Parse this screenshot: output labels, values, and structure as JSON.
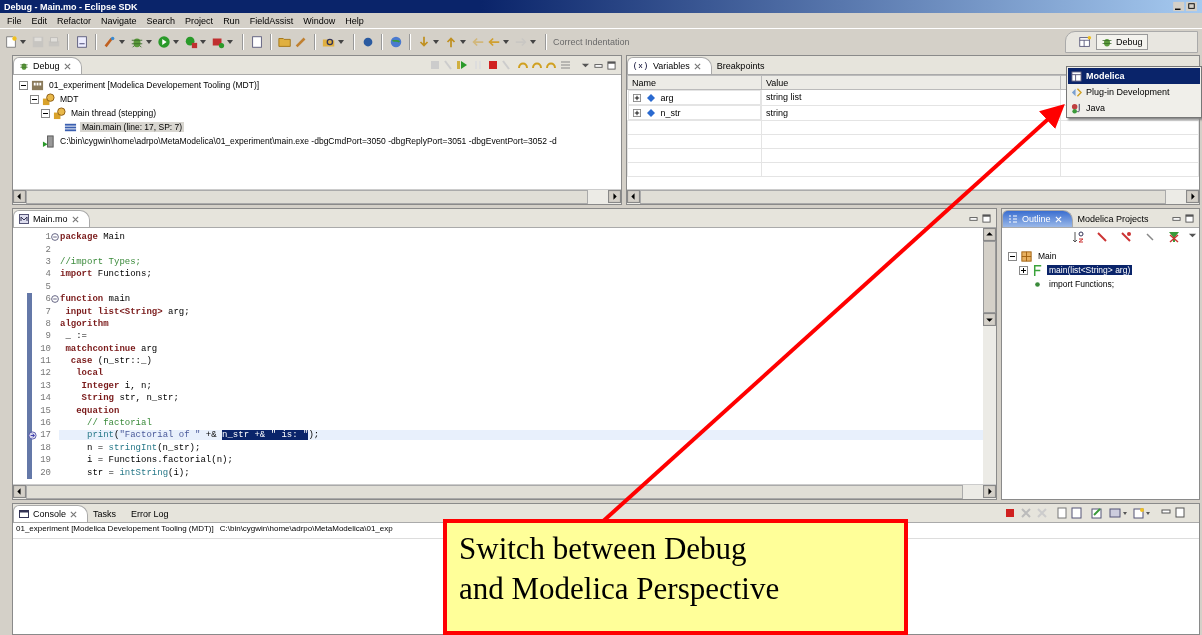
{
  "window": {
    "title": "Debug - Main.mo - Eclipse SDK"
  },
  "menu": [
    "File",
    "Edit",
    "Refactor",
    "Navigate",
    "Search",
    "Project",
    "Run",
    "FieldAssist",
    "Window",
    "Help"
  ],
  "toolbar": {
    "action": "Correct Indentation",
    "action_disabled": true
  },
  "perspectives": {
    "current": "Debug",
    "menu": [
      {
        "label": "Modelica",
        "kind": "modelica",
        "selected": true
      },
      {
        "label": "Plug-in Development",
        "kind": "plugin",
        "selected": false
      },
      {
        "label": "Java",
        "kind": "java",
        "selected": false
      }
    ]
  },
  "debug_view": {
    "focused": false,
    "tabs": [
      {
        "label": "Debug",
        "selected": true
      }
    ],
    "tree": [
      {
        "label": "01_experiment [Modelica Developement Tooling (MDT)]",
        "kind": "launch",
        "selected": false,
        "expanded": true,
        "children": [
          {
            "label": "MDT",
            "kind": "target",
            "selected": false,
            "expanded": true,
            "children": [
              {
                "label": "Main thread (stepping)",
                "kind": "thread",
                "selected": false,
                "expanded": true,
                "children": [
                  {
                    "label": "Main.main (line: 17, SP: 7)",
                    "kind": "frame",
                    "selected": true
                  }
                ]
              }
            ]
          },
          {
            "label": "C:\\bin\\cygwin\\home\\adrpo\\MetaModelica\\01_experiment\\main.exe -dbgCmdPort=3050 -dbgReplyPort=3051 -dbgEventPort=3052 -d",
            "kind": "process",
            "selected": false
          }
        ]
      }
    ]
  },
  "variables_view": {
    "focused": false,
    "tabs": [
      {
        "label": "Variables",
        "selected": true
      },
      {
        "label": "Breakpoints",
        "selected": false
      }
    ],
    "columns": [
      "Name",
      "Value"
    ],
    "rows": [
      {
        "name": "arg",
        "value": "string list"
      },
      {
        "name": "n_str",
        "value": "string"
      }
    ]
  },
  "editor": {
    "focused": false,
    "tabs": [
      {
        "label": "Main.mo",
        "selected": true
      }
    ],
    "lines": [
      {
        "number": "1",
        "fold": true,
        "changed": false,
        "current": false,
        "segments": [
          {
            "kind": "kw",
            "text": "package"
          },
          {
            "kind": "plain",
            "text": " Main"
          }
        ]
      },
      {
        "number": "2",
        "fold": false,
        "changed": false,
        "current": false
      },
      {
        "number": "3",
        "fold": false,
        "changed": false,
        "current": false,
        "segments": [
          {
            "kind": "comment",
            "text": "//import Types;"
          }
        ]
      },
      {
        "number": "4",
        "fold": false,
        "changed": false,
        "current": false,
        "segments": [
          {
            "kind": "kw",
            "text": "import"
          },
          {
            "kind": "plain",
            "text": " Functions;"
          }
        ]
      },
      {
        "number": "5",
        "fold": false,
        "changed": false,
        "current": false
      },
      {
        "number": "6",
        "fold": true,
        "changed": true,
        "current": false,
        "segments": [
          {
            "kind": "kw",
            "text": "function"
          },
          {
            "kind": "plain",
            "text": " main"
          }
        ]
      },
      {
        "number": "7",
        "fold": false,
        "changed": true,
        "current": false,
        "segments": [
          {
            "kind": "kw",
            "text": " input list<String>"
          },
          {
            "kind": "plain",
            "text": " arg;"
          }
        ]
      },
      {
        "number": "8",
        "fold": false,
        "changed": true,
        "current": false,
        "segments": [
          {
            "kind": "kw",
            "text": "algorithm"
          }
        ]
      },
      {
        "number": "9",
        "fold": false,
        "changed": true,
        "current": false,
        "segments": [
          {
            "kind": "plain",
            "text": " _ :="
          }
        ]
      },
      {
        "number": "10",
        "fold": false,
        "changed": true,
        "current": false,
        "segments": [
          {
            "kind": "kw",
            "text": " matchcontinue"
          },
          {
            "kind": "plain",
            "text": " arg"
          }
        ]
      },
      {
        "number": "11",
        "fold": false,
        "changed": true,
        "current": false,
        "segments": [
          {
            "kind": "kw",
            "text": "  case"
          },
          {
            "kind": "plain",
            "text": " (n_str::_)"
          }
        ]
      },
      {
        "number": "12",
        "fold": false,
        "changed": true,
        "current": false,
        "segments": [
          {
            "kind": "kw",
            "text": "   local"
          }
        ]
      },
      {
        "number": "13",
        "fold": false,
        "changed": true,
        "current": false,
        "segments": [
          {
            "kind": "kw",
            "text": "    Integer"
          },
          {
            "kind": "plain",
            "text": " i, n;"
          }
        ]
      },
      {
        "number": "14",
        "fold": false,
        "changed": true,
        "current": false,
        "segments": [
          {
            "kind": "kw",
            "text": "    String"
          },
          {
            "kind": "plain",
            "text": " str, n_str;"
          }
        ]
      },
      {
        "number": "15",
        "fold": false,
        "changed": true,
        "current": false,
        "segments": [
          {
            "kind": "kw",
            "text": "   equation"
          }
        ]
      },
      {
        "number": "16",
        "fold": false,
        "changed": true,
        "current": false,
        "segments": [
          {
            "kind": "comment",
            "text": "     // factorial"
          }
        ]
      },
      {
        "number": "17",
        "fold": false,
        "changed": true,
        "current": true,
        "segments": [
          {
            "kind": "fn",
            "text": "     print"
          },
          {
            "kind": "plain",
            "text": "("
          },
          {
            "kind": "str",
            "text": "\"Factorial of \""
          },
          {
            "kind": "plain",
            "text": " +& "
          },
          {
            "kind": "sel",
            "text": "n_str +& \" is: \""
          },
          {
            "kind": "plain",
            "text": ");"
          }
        ]
      },
      {
        "number": "18",
        "fold": false,
        "changed": true,
        "current": false,
        "segments": [
          {
            "kind": "plain",
            "text": "     n = "
          },
          {
            "kind": "fn",
            "text": "stringInt"
          },
          {
            "kind": "plain",
            "text": "(n_str);"
          }
        ]
      },
      {
        "number": "19",
        "fold": false,
        "changed": true,
        "current": false,
        "segments": [
          {
            "kind": "plain",
            "text": "     i = Functions.factorial(n);"
          }
        ]
      },
      {
        "number": "20",
        "fold": false,
        "changed": true,
        "current": false,
        "segments": [
          {
            "kind": "plain",
            "text": "     str = "
          },
          {
            "kind": "fn",
            "text": "intString"
          },
          {
            "kind": "plain",
            "text": "(i);"
          }
        ]
      }
    ]
  },
  "outline": {
    "focused": true,
    "tabs": [
      {
        "label": "Outline",
        "selected": true
      },
      {
        "label": "Modelica Projects",
        "selected": false
      }
    ],
    "tree": [
      {
        "label": "Main",
        "kind": "package",
        "selected": false,
        "expanded": true,
        "children": [
          {
            "label": "main(list<String> arg)",
            "kind": "function",
            "selected": true,
            "expanded": false
          },
          {
            "label": "import Functions;",
            "kind": "import",
            "selected": false
          }
        ]
      }
    ]
  },
  "console": {
    "focused": false,
    "tabs": [
      {
        "label": "Console",
        "selected": true
      },
      {
        "label": "Tasks",
        "selected": false
      },
      {
        "label": "Error Log",
        "selected": false
      }
    ],
    "launch": "01_experiment [Modelica Developement Tooling (MDT)]",
    "path": "C:\\bin\\cygwin\\home\\adrpo\\MetaModelica\\01_exp"
  },
  "callout": {
    "lines": [
      "Switch between Debug",
      "and Modelica Perspective"
    ]
  }
}
